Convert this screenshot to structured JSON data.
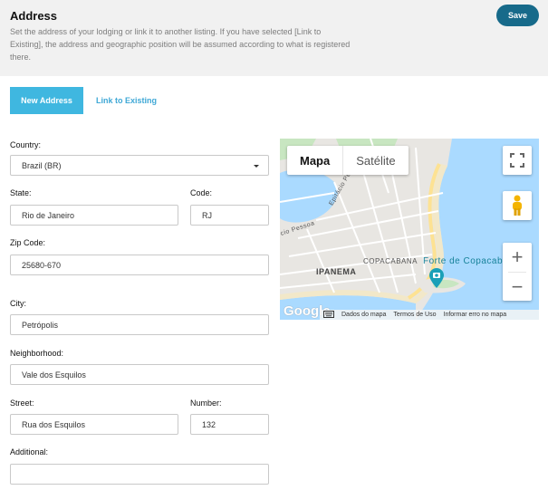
{
  "header": {
    "title": "Address",
    "description": "Set the address of your lodging or link it to another listing. If you have selected [Link to Existing], the address and geographic position will be assumed according to what is registered there.",
    "save_label": "Save"
  },
  "tabs": [
    {
      "label": "New Address",
      "active": true
    },
    {
      "label": "Link to Existing",
      "active": false
    }
  ],
  "form": {
    "country": {
      "label": "Country:",
      "value": "Brazil (BR)"
    },
    "state": {
      "label": "State:",
      "value": "Rio de Janeiro"
    },
    "code": {
      "label": "Code:",
      "value": "RJ"
    },
    "zip": {
      "label": "Zip Code:",
      "value": "25680-670"
    },
    "city": {
      "label": "City:",
      "value": "Petrópolis"
    },
    "neighborhood": {
      "label": "Neighborhood:",
      "value": "Vale dos Esquilos"
    },
    "street": {
      "label": "Street:",
      "value": "Rua dos Esquilos"
    },
    "number": {
      "label": "Number:",
      "value": "132"
    },
    "additional": {
      "label": "Additional:",
      "value": ""
    }
  },
  "map": {
    "type_map": "Mapa",
    "type_satellite": "Satélite",
    "active_type": "Mapa",
    "labels": {
      "ipanema": "IPANEMA",
      "copacabana": "COPACABANA",
      "forte": "Forte de Copacabana",
      "street1": "cio Pessoa",
      "street2": "Epitácio Pessoa"
    },
    "logo": "Google",
    "footer": [
      "Dados do mapa",
      "Termos de Uso",
      "Informar erro no mapa"
    ],
    "icons": [
      "fullscreen-icon",
      "pegman-icon",
      "zoom-in-icon",
      "zoom-out-icon",
      "keyboard-icon",
      "camera-marker-icon"
    ],
    "colors": {
      "water": "#aadaff",
      "land": "#e8e6e2",
      "road": "#ffffff",
      "highway": "#fde293",
      "park": "#c8e6c1",
      "beach": "#f2e8c9"
    }
  },
  "colors": {
    "accent": "#3fb7e0",
    "save": "#176a8a",
    "header_bg": "#f1f1f1"
  }
}
